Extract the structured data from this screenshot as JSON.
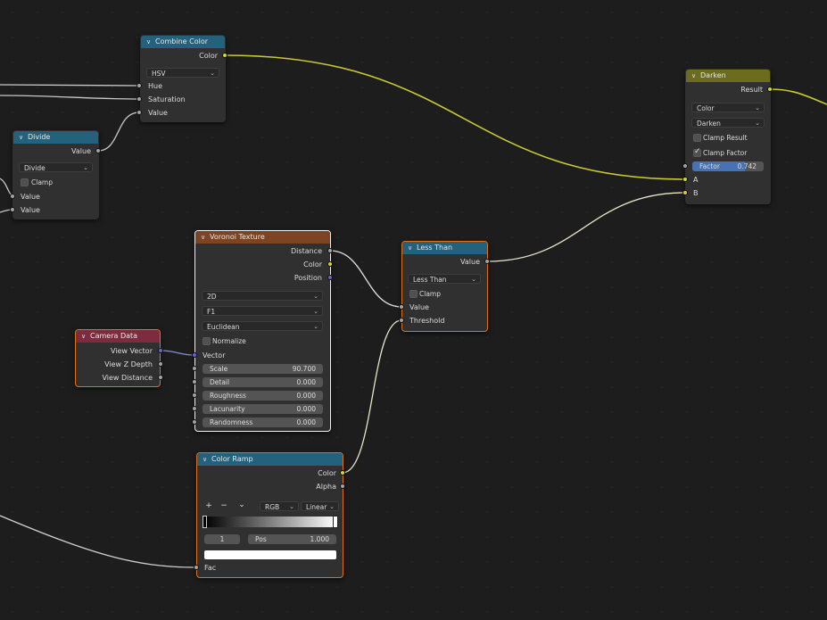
{
  "colors": {
    "yellow_socket": "#d5d52c",
    "gray_socket": "#a3a3a3",
    "purple_socket": "#6465d0",
    "header_blue": "#24617c",
    "header_olive": "#6c6c1e",
    "header_brown": "#7c4420",
    "header_red": "#7d2c3f",
    "selection_orange": "#e0701e",
    "factor_blue": "#4772b3"
  },
  "combine_color": {
    "title": "Combine Color",
    "out_color": "Color",
    "mode": "HSV",
    "in_hue": "Hue",
    "in_saturation": "Saturation",
    "in_value": "Value"
  },
  "divide": {
    "title": "Divide",
    "out_value": "Value",
    "operation": "Divide",
    "clamp": "Clamp",
    "in_value1": "Value",
    "in_value2": "Value"
  },
  "darken": {
    "title": "Darken",
    "out_result": "Result",
    "data_type": "Color",
    "blend_mode": "Darken",
    "clamp_result": "Clamp Result",
    "clamp_factor": "Clamp Factor",
    "clamp_factor_checked": true,
    "factor_label": "Factor",
    "factor_value": "0.742",
    "factor_fraction": 0.742,
    "in_a": "A",
    "in_b": "B"
  },
  "voronoi": {
    "title": "Voronoi Texture",
    "out_distance": "Distance",
    "out_color": "Color",
    "out_position": "Position",
    "dimensions": "2D",
    "feature": "F1",
    "metric": "Euclidean",
    "normalize": "Normalize",
    "in_vector": "Vector",
    "fields": [
      {
        "label": "Scale",
        "value": "90.700"
      },
      {
        "label": "Detail",
        "value": "0.000"
      },
      {
        "label": "Roughness",
        "value": "0.000"
      },
      {
        "label": "Lacunarity",
        "value": "0.000"
      },
      {
        "label": "Randomness",
        "value": "0.000"
      }
    ]
  },
  "less_than": {
    "title": "Less Than",
    "out_value": "Value",
    "operation": "Less Than",
    "clamp": "Clamp",
    "in_value": "Value",
    "in_threshold": "Threshold"
  },
  "camera_data": {
    "title": "Camera Data",
    "out_view_vector": "View Vector",
    "out_view_z_depth": "View Z Depth",
    "out_view_distance": "View Distance"
  },
  "color_ramp": {
    "title": "Color Ramp",
    "out_color": "Color",
    "out_alpha": "Alpha",
    "add_glyph": "+",
    "remove_glyph": "−",
    "menu_glyph": "⌄",
    "color_mode": "RGB",
    "interpolation": "Linear",
    "active_index": "1",
    "pos_label": "Pos",
    "pos_value": "1.000",
    "in_fac": "Fac"
  }
}
